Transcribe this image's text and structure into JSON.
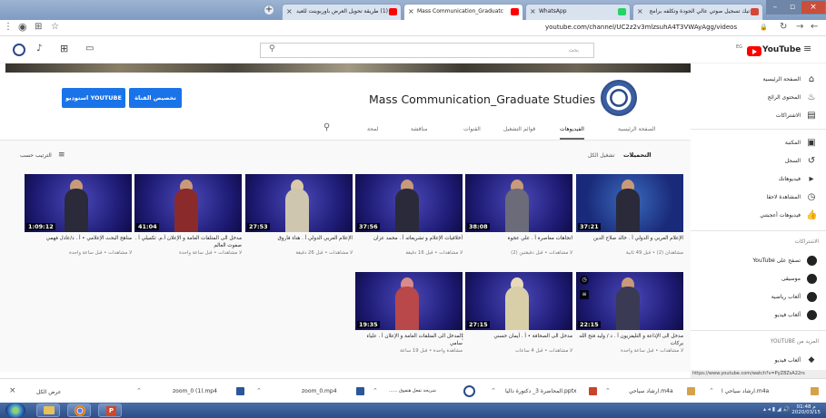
{
  "browser": {
    "tabs": [
      {
        "title": "تيك تسجيل صوتي عالي الجودة وتكلفه برامج",
        "favicon_color": "#d44638",
        "active": false
      },
      {
        "title": "(1) طريقة تحويل العرض باوربوينت للعيد",
        "favicon_color": "#ff0000",
        "active": false
      },
      {
        "title": "Mass Communication_Graduatc",
        "favicon_color": "#ff0000",
        "active": true
      },
      {
        "title": "WhatsApp",
        "favicon_color": "#25d366",
        "active": false
      }
    ],
    "url": "youtube.com/channel/UC2z2v3mlzsuhA4T3VWAyAgg/videos"
  },
  "masthead": {
    "search_placeholder": "بحث",
    "logo_text": "YouTube",
    "logo_country": "EG"
  },
  "channel": {
    "title": "Mass Communication_Graduate Studies",
    "customize_label": "تخصيص القناة",
    "studio_label": "استوديو YOUTUBE",
    "tabs": [
      "الصفحة الرئيسية",
      "الفيديوهات",
      "قوائم التشغيل",
      "القنوات",
      "مناقشة",
      "لمحة"
    ],
    "selected_tab": "الفيديوهات"
  },
  "uploads": {
    "heading": "التحميلات",
    "play_all": "تشغيل الكل",
    "sort_label": "الترتيب حسب",
    "videos": [
      {
        "title": "الإعلام العربي و الدولي أ . خالد صلاح الدين",
        "meta": "مشاهدان (2) • قبل 49 ثانية",
        "duration": "37:21"
      },
      {
        "title": "اتجاهات معاصرة أ . علي عجوة",
        "meta": "لا مشاهدات • قبل دقيقتين (2)",
        "duration": "38:08"
      },
      {
        "title": "أخلاقيات الإعلام و تشريعاته أ . محمد عزان",
        "meta": "لا مشاهدات • قبل 16 دقيقة",
        "duration": "37:56"
      },
      {
        "title": "الإعلام العربي الدولي أ . هناء فاروق",
        "meta": "لا مشاهدات • قبل 26 دقيقة",
        "duration": "27:53"
      },
      {
        "title": "مدخل الى المتلقات العامة و الإعلان أ.م. تكميلي أ . صفوت العالم",
        "meta": "لا مشاهدات • قبل ساعة واحدة",
        "duration": "41:04"
      },
      {
        "title": "مناهج البحث الإعلامي • أ . د/عادل فهمي",
        "meta": "لا مشاهدات • قبل ساعة واحدة",
        "duration": "1:09:12"
      },
      {
        "title": "مدخل الى الإذاعة و التليفزيون أ . د / وليد فتح الله بركات",
        "meta": "لا مشاهدات • قبل ساعة واحدة",
        "duration": "22:15"
      },
      {
        "title": "مدخل الى الصحافة • أ . أيمان حسني",
        "meta": "لا مشاهدات • قبل 4 ساعات",
        "duration": "27:15"
      },
      {
        "title": "المدخل الى المتلقات العامة و الإعلان أ . علياء سامي",
        "meta": "مشاهدة واحدة • قبل 19 ساعة",
        "duration": "19:35"
      }
    ]
  },
  "sidebar": {
    "main": [
      {
        "label": "الصفحة الرئيسية",
        "icon": "home-icon",
        "glyph": "⌂"
      },
      {
        "label": "المحتوى الرائج",
        "icon": "flame-icon",
        "glyph": "♨"
      },
      {
        "label": "الاشتراكات",
        "icon": "subscriptions-icon",
        "glyph": "▤"
      }
    ],
    "library": [
      {
        "label": "المكتبة",
        "icon": "library-icon",
        "glyph": "▣"
      },
      {
        "label": "السجل",
        "icon": "history-icon",
        "glyph": "↺"
      },
      {
        "label": "فيديوهاتك",
        "icon": "your-videos-icon",
        "glyph": "▸"
      },
      {
        "label": "المشاهدة لاحقا",
        "icon": "watch-later-icon",
        "glyph": "◷"
      },
      {
        "label": "فيديوهات أعجبتني",
        "icon": "liked-icon",
        "glyph": "👍"
      }
    ],
    "subs_heading": "الاشتراكات",
    "subscriptions": [
      {
        "label": "تصفح على YouTube",
        "icon": "browse-channels-icon"
      },
      {
        "label": "موسيقى",
        "icon": "music-icon"
      },
      {
        "label": "ألعاب رياضية",
        "icon": "sports-icon"
      },
      {
        "label": "ألعاب فيديو",
        "icon": "gaming-icon"
      }
    ],
    "more_heading": "المزيد من YOUTUBE",
    "more": [
      {
        "label": "ألعاب فيديو",
        "icon": "gaming-more-icon"
      }
    ]
  },
  "status_url": "https://www.youtube.com/watch?v=PyZ8ZsA22rs",
  "downloads": {
    "show_all": "عرض الكل",
    "items": [
      {
        "name": "zoom_0 (1).mp4"
      },
      {
        "name": "zoom_0.mp4"
      },
      {
        "name": "...... شريحة تفعل هتفوق"
      },
      {
        "name": "المحاضرة 3_ دكتورة داليا.pptx"
      },
      {
        "name": "ارشاد سياحي.m4a"
      },
      {
        "name": "ارشاد سياحي ا.m4a"
      }
    ]
  },
  "taskbar": {
    "time": "01:48 م",
    "date": "2020/03/15"
  }
}
